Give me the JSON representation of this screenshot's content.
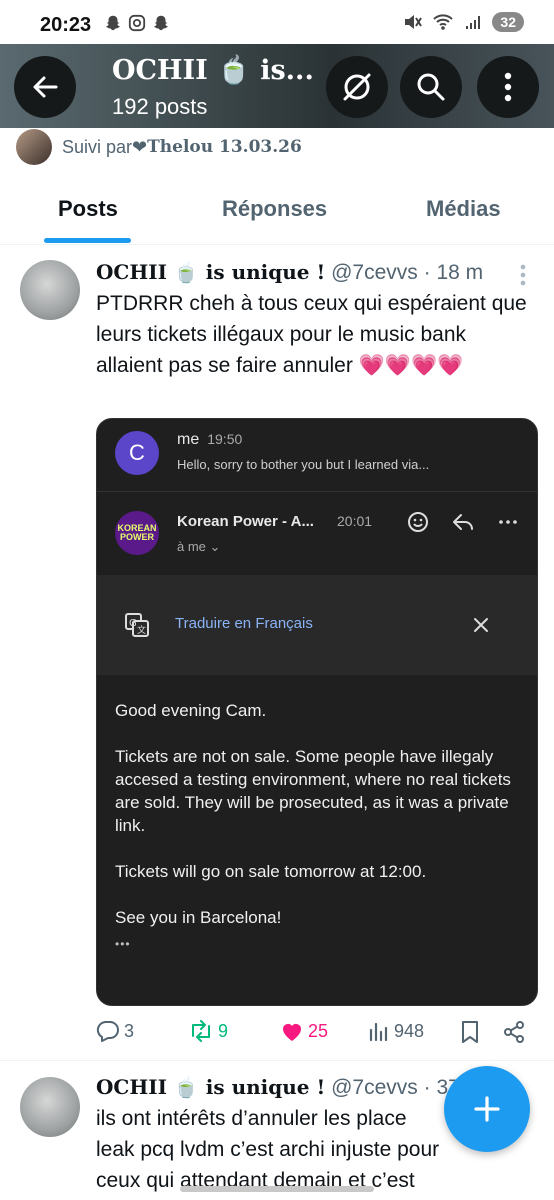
{
  "status_bar": {
    "time": "20:23",
    "battery": "32",
    "signal_label": "6"
  },
  "header": {
    "title": "OCHII 🍵 is...",
    "subtitle": "192 posts"
  },
  "followed_by": {
    "prefix": "Suivi par ",
    "heart": "❤",
    "name": " Thelou 13.03.26"
  },
  "tabs": [
    {
      "label": "Posts"
    },
    {
      "label": "Réponses"
    },
    {
      "label": "Médias"
    }
  ],
  "post1": {
    "name": "OCHII 🍵 is unique !",
    "handle": " @7cevvs · 18 m",
    "text": "PTDRRR cheh à tous ceux qui espéraient que leurs tickets illégaux pour le music bank allaient pas se faire annuler ",
    "hearts": "💗💗💗💗",
    "email": {
      "first_sender_initial": "C",
      "first_sender": "me",
      "first_time": "19:50",
      "first_snippet": "Hello, sorry to bother you but I learned via...",
      "logo_text": "KOREAN POWER",
      "sender": "Korean Power - A...",
      "sender_time": "20:01",
      "to": "à me  ⌄",
      "translate_label": "Traduire en Français",
      "body": [
        "Good evening Cam.",
        "Tickets are not on sale. Some people have illegaly accesed a testing environment, where no real tickets are sold. They will be prosecuted, as it was a private link.",
        "Tickets will go on sale tomorrow at  12:00.",
        "See you in Barcelona!"
      ],
      "ellipsis": "•••"
    },
    "actions": {
      "replies": "3",
      "reposts": "9",
      "likes": "25",
      "views": "948"
    }
  },
  "post2": {
    "name": "OCHII 🍵 is unique !",
    "handle": " @7cevvs · 37",
    "text_line1": "ils ont intérêts d’annuler les place",
    "text_line2": "leak pcq lvdm c’est archi injuste pour",
    "text_line3": "ceux qui attendant demain et c’est"
  },
  "colors": {
    "accent": "#1d9bf0",
    "like": "#f91880",
    "repost": "#00ba7c",
    "muted": "#536471"
  }
}
